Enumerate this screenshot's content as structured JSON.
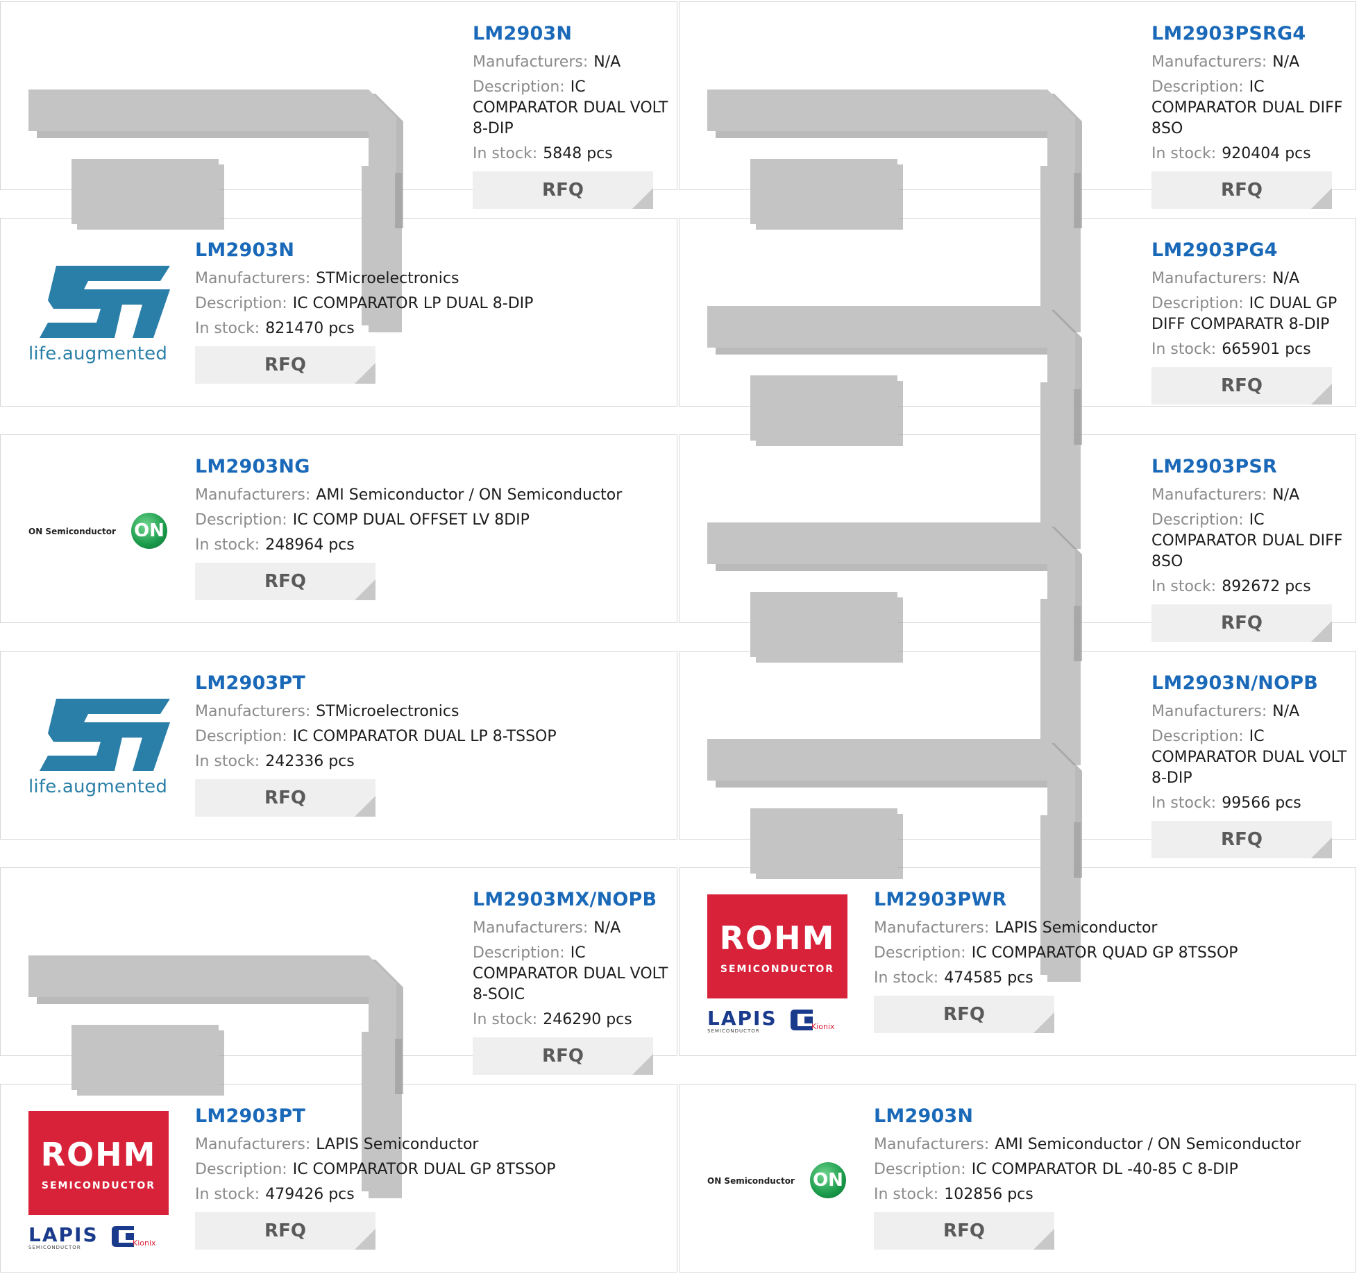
{
  "labels": {
    "manufacturers": "Manufacturers:",
    "description": "Description:",
    "in_stock": "In stock:"
  },
  "products": [
    {
      "part": "LM2903N",
      "manufacturer": "N/A",
      "description": "IC COMPARATOR DUAL VOLT 8-DIP",
      "stock": "5848 pcs",
      "rfq": "RFQ",
      "logo": "placeholder-chip"
    },
    {
      "part": "LM2903PSRG4",
      "manufacturer": "N/A",
      "description": "IC COMPARATOR DUAL DIFF 8SO",
      "stock": "920404 pcs",
      "rfq": "RFQ",
      "logo": "placeholder-chip"
    },
    {
      "part": "LM2903N",
      "manufacturer": "STMicroelectronics",
      "description": "IC COMPARATOR LP DUAL 8-DIP",
      "stock": "821470 pcs",
      "rfq": "RFQ",
      "logo": "st-logo"
    },
    {
      "part": "LM2903PG4",
      "manufacturer": "N/A",
      "description": "IC DUAL GP DIFF COMPARATR 8-DIP",
      "stock": "665901 pcs",
      "rfq": "RFQ",
      "logo": "placeholder-chip"
    },
    {
      "part": "LM2903NG",
      "manufacturer": "AMI Semiconductor / ON Semiconductor",
      "description": "IC COMP DUAL OFFSET LV 8DIP",
      "stock": "248964 pcs",
      "rfq": "RFQ",
      "logo": "on-semi-logo"
    },
    {
      "part": "LM2903PSR",
      "manufacturer": "N/A",
      "description": "IC COMPARATOR DUAL DIFF 8SO",
      "stock": "892672 pcs",
      "rfq": "RFQ",
      "logo": "placeholder-chip"
    },
    {
      "part": "LM2903PT",
      "manufacturer": "STMicroelectronics",
      "description": "IC COMPARATOR DUAL LP 8-TSSOP",
      "stock": "242336 pcs",
      "rfq": "RFQ",
      "logo": "st-logo"
    },
    {
      "part": "LM2903N/NOPB",
      "manufacturer": "N/A",
      "description": "IC COMPARATOR DUAL VOLT 8-DIP",
      "stock": "99566 pcs",
      "rfq": "RFQ",
      "logo": "placeholder-chip"
    },
    {
      "part": "LM2903MX/NOPB",
      "manufacturer": "N/A",
      "description": "IC COMPARATOR DUAL VOLT 8-SOIC",
      "stock": "246290 pcs",
      "rfq": "RFQ",
      "logo": "placeholder-chip"
    },
    {
      "part": "LM2903PWR",
      "manufacturer": "LAPIS Semiconductor",
      "description": "IC COMPARATOR QUAD GP 8TSSOP",
      "stock": "474585 pcs",
      "rfq": "RFQ",
      "logo": "rohm-lapis-logo"
    },
    {
      "part": "LM2903PT",
      "manufacturer": "LAPIS Semiconductor",
      "description": "IC COMPARATOR DUAL GP 8TSSOP",
      "stock": "479426 pcs",
      "rfq": "RFQ",
      "logo": "rohm-lapis-logo"
    },
    {
      "part": "LM2903N",
      "manufacturer": "AMI Semiconductor / ON Semiconductor",
      "description": "IC COMPARATOR DL -40-85 C 8-DIP",
      "stock": "102856 pcs",
      "rfq": "RFQ",
      "logo": "on-semi-logo"
    }
  ],
  "logos": {
    "st_text": "life.augmented",
    "on_text": "ON Semiconductor",
    "on_mark": "ON",
    "rohm_name": "ROHM",
    "rohm_sub": "SEMICONDUCTOR",
    "lapis_name": "LAPIS",
    "lapis_sub": "SEMICONDUCTOR",
    "kionix": "Kionix"
  },
  "colors": {
    "part_link": "#1a69b8",
    "label": "#8a8a8a",
    "rfq_bg": "#efefef",
    "rohm_red": "#d8223a",
    "st_blue": "#2a7fa8",
    "on_green": "#1a9a4a"
  }
}
